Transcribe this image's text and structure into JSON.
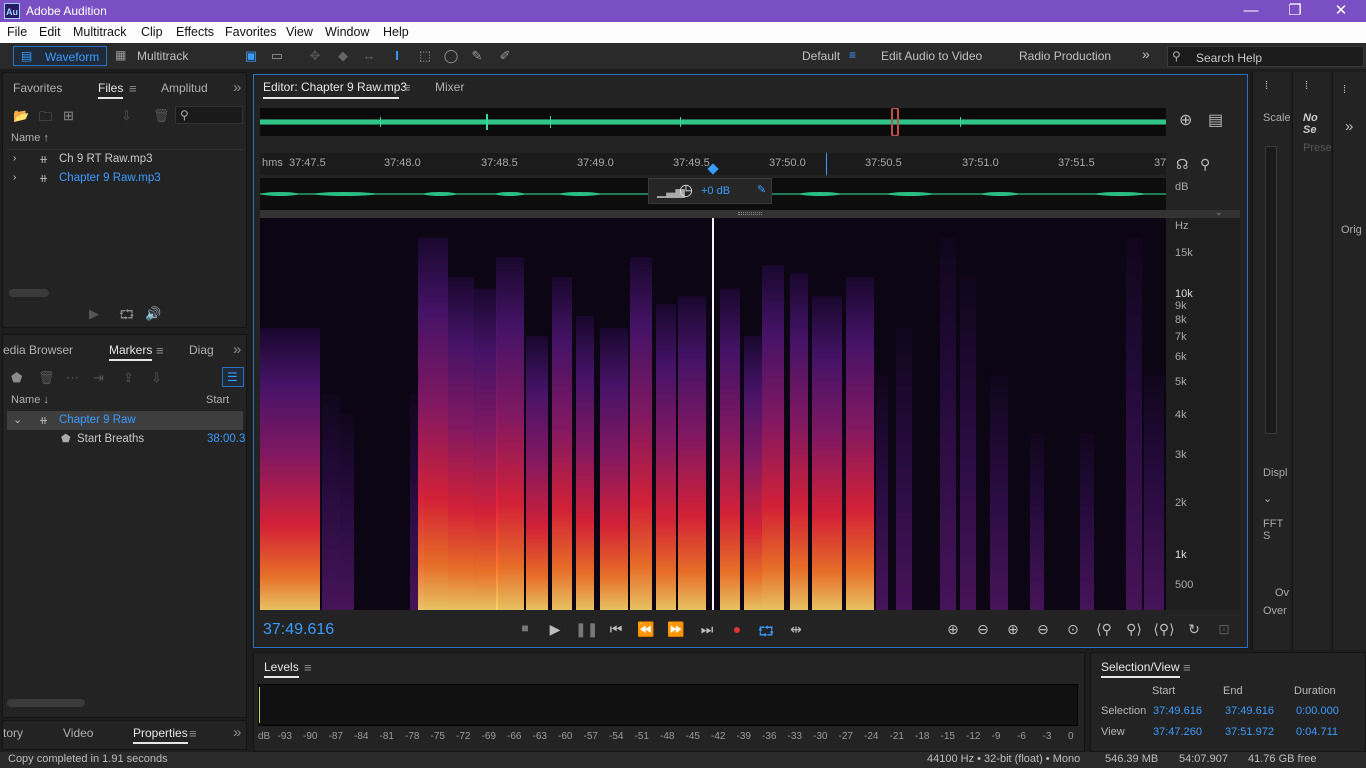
{
  "app": {
    "logo": "Au",
    "title": "Adobe Audition"
  },
  "window_controls": {
    "minimize": "—",
    "restore": "❐",
    "close": "✕"
  },
  "menu": [
    "File",
    "Edit",
    "Multitrack",
    "Clip",
    "Effects",
    "Favorites",
    "View",
    "Window",
    "Help"
  ],
  "toolbar": {
    "waveform": "Waveform",
    "multitrack": "Multitrack",
    "workspaces": [
      "Default",
      "Edit Audio to Video",
      "Radio Production"
    ],
    "more": "»",
    "search_placeholder": "Search Help"
  },
  "files_panel": {
    "tabs": [
      "Favorites",
      "Files",
      "Amplitud"
    ],
    "column": "Name ↑",
    "items": [
      {
        "name": "Ch 9 RT Raw.mp3",
        "active": false
      },
      {
        "name": "Chapter 9 Raw.mp3",
        "active": true
      }
    ]
  },
  "markers_panel": {
    "tabs": [
      "edia Browser",
      "Markers",
      "Diag"
    ],
    "columns": {
      "name": "Name ↓",
      "start": "Start"
    },
    "group": "Chapter 9 Raw",
    "marker": {
      "name": "Start Breaths",
      "start": "38:00.3"
    }
  },
  "bottom_left_tabs": [
    "tory",
    "Video",
    "Properties"
  ],
  "editor": {
    "tab": "Editor: Chapter 9 Raw.mp3",
    "mixer": "Mixer",
    "ruler_unit": "hms",
    "ticks": [
      "37:47.5",
      "37:48.0",
      "37:48.5",
      "37:49.0",
      "37:49.5",
      "37:50.0",
      "37:50.5",
      "37:51.0",
      "37:51.5",
      "37"
    ],
    "db_label": "dB",
    "gain": "+0 dB",
    "hz_label": "Hz",
    "freq_ticks": [
      "15k",
      "10k",
      "9k",
      "8k",
      "7k",
      "6k",
      "5k",
      "4k",
      "3k",
      "2k",
      "1k",
      "500"
    ],
    "current_time": "37:49.616"
  },
  "levels": {
    "title": "Levels",
    "scale": [
      "dB",
      "-93",
      "-90",
      "-87",
      "-84",
      "-81",
      "-78",
      "-75",
      "-72",
      "-69",
      "-66",
      "-63",
      "-60",
      "-57",
      "-54",
      "-51",
      "-48",
      "-45",
      "-42",
      "-39",
      "-36",
      "-33",
      "-30",
      "-27",
      "-24",
      "-21",
      "-18",
      "-15",
      "-12",
      "-9",
      "-6",
      "-3",
      "0"
    ]
  },
  "selection_view": {
    "title": "Selection/View",
    "headers": [
      "Start",
      "End",
      "Duration"
    ],
    "selection": {
      "label": "Selection",
      "start": "37:49.616",
      "end": "37:49.616",
      "duration": "0:00.000"
    },
    "view": {
      "label": "View",
      "start": "37:47.260",
      "end": "37:51.972",
      "duration": "0:04.711"
    }
  },
  "right_panel": {
    "scale": "Scale",
    "no_selection": "No Se",
    "preset": "Prese",
    "orig": "Orig",
    "display": "Displ",
    "fft": "FFT S",
    "ov": "Ov",
    "over": "Over"
  },
  "status": {
    "message": "Copy completed in 1.91 seconds",
    "format": "44100 Hz • 32-bit (float) • Mono",
    "size": "546.39 MB",
    "duration": "54:07.907",
    "free": "41.76 GB free"
  }
}
